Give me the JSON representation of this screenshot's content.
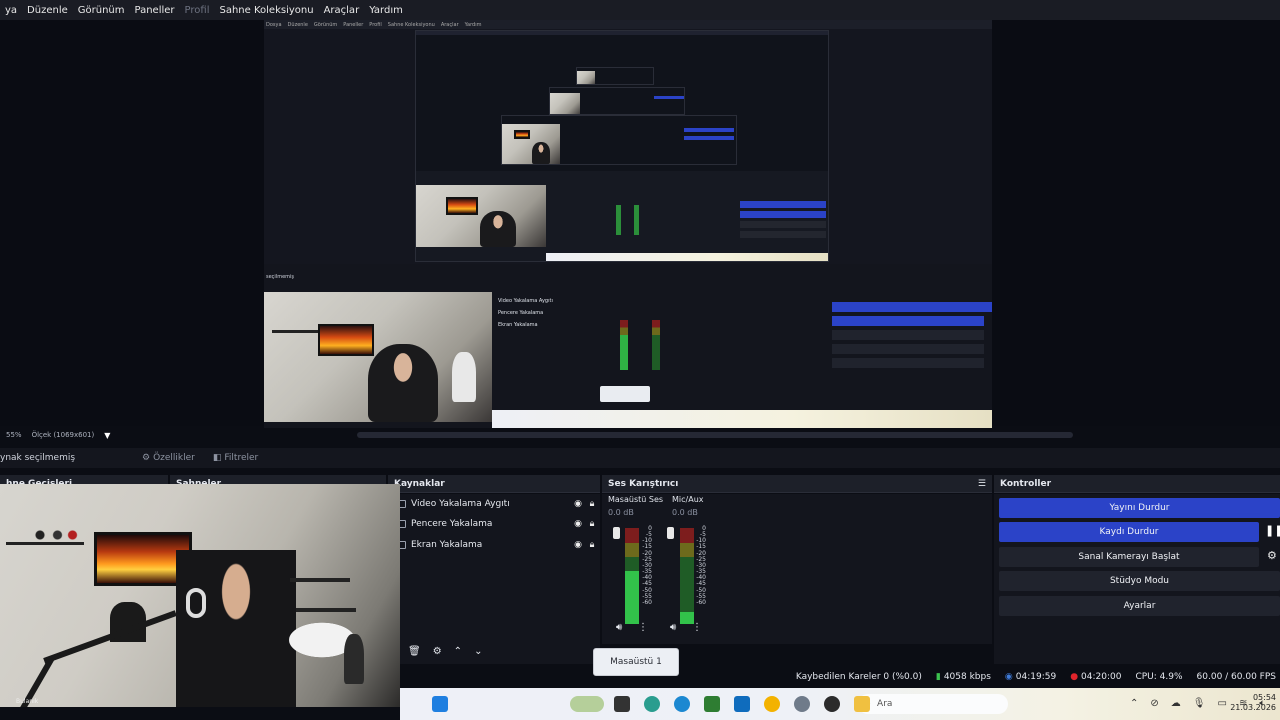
{
  "menu": [
    "ya",
    "Düzenle",
    "Görünüm",
    "Paneller",
    "Profil",
    "Sahne Koleksiyonu",
    "Araçlar",
    "Yardım"
  ],
  "menu_disabled": "Profil",
  "preview_status": {
    "zoom": "55%",
    "scale": "Ölçek (1069x601)"
  },
  "source_toolbar": {
    "no_source": "ynak seçilmemiş",
    "properties": "Özellikler",
    "filters": "Filtreler"
  },
  "docks": {
    "scenes_partial": "hne Geçişleri",
    "scenes2_partial": "Sahneler",
    "sources_title": "Kaynaklar",
    "mixer_title": "Ses Karıştırıcı",
    "controls_title": "Kontroller"
  },
  "sources": [
    {
      "name": "Video Yakalama Aygıtı"
    },
    {
      "name": "Pencere Yakalama"
    },
    {
      "name": "Ekran Yakalama"
    }
  ],
  "mixer": [
    {
      "name": "Masaüstü Ses",
      "db": "0.0 dB",
      "level": 0.55
    },
    {
      "name": "Mic/Aux",
      "db": "0.0 dB",
      "level": 0.12
    }
  ],
  "meter_scale": [
    "0",
    "-5",
    "-10",
    "-15",
    "-20",
    "-25",
    "-30",
    "-35",
    "-40",
    "-45",
    "-50",
    "-55",
    "-60"
  ],
  "controls": [
    {
      "label": "Yayını Durdur",
      "active": true
    },
    {
      "label": "Kaydı Durdur",
      "active": true
    },
    {
      "label": "Sanal Kamerayı Başlat",
      "active": false
    },
    {
      "label": "Stüdyo Modu",
      "active": false
    },
    {
      "label": "Ayarlar",
      "active": false
    }
  ],
  "status": {
    "dropped": "Kaybedilen Kareler 0 (%0.0)",
    "bitrate": "4058 kbps",
    "stream_time": "04:19:59",
    "rec_time": "04:20:00",
    "cpu": "CPU: 4.9%",
    "fps": "60.00 / 60.00 FPS"
  },
  "tooltip": "Masaüstü 1",
  "taskbar": {
    "search": "Ara",
    "time": "05:54",
    "date": "21.03.2026"
  },
  "webcam_caption": "Bulanık",
  "nested_mini_menu": [
    "Dosya",
    "Düzenle",
    "Görünüm",
    "Paneller",
    "Profil",
    "Sahne Koleksiyonu",
    "Araçlar",
    "Yardım"
  ],
  "colors": {
    "accent": "#2b43c8",
    "bg": "#0b0d14",
    "panel": "#13151d"
  }
}
